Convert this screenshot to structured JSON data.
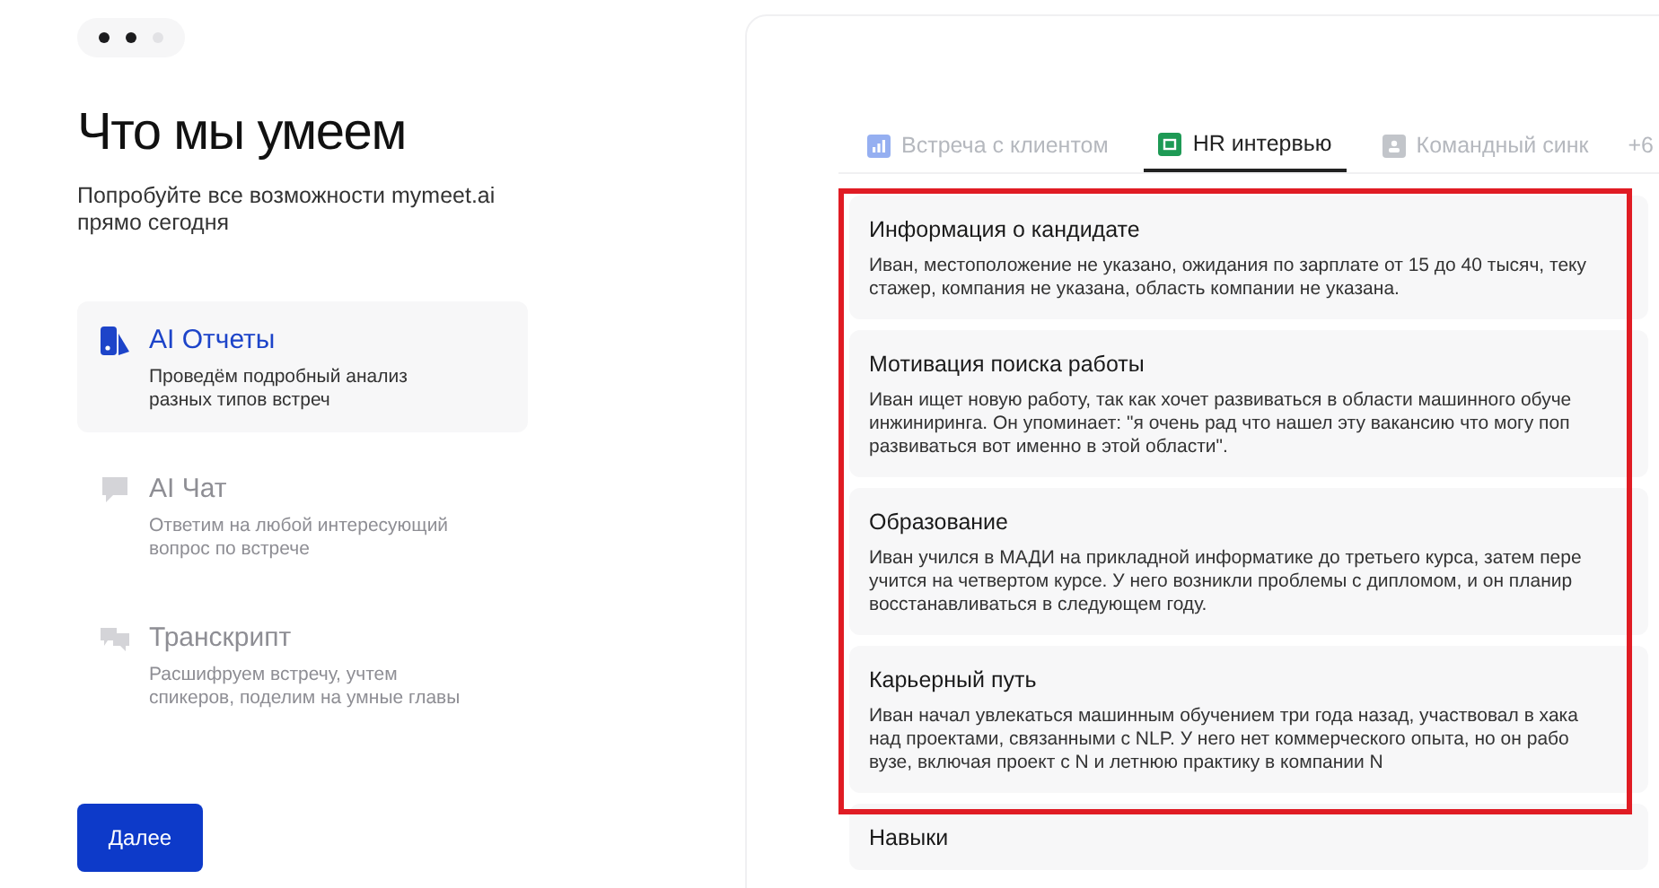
{
  "steps": [
    {
      "active": true
    },
    {
      "active": true
    },
    {
      "active": false
    }
  ],
  "title": "Что мы умеем",
  "subtitle": "Попробуйте все возможности mymeet.ai прямо сегодня",
  "features": [
    {
      "kind": "reports",
      "title": "AI Отчеты",
      "description": "Проведём подробный анализ разных типов встреч",
      "selected": true
    },
    {
      "kind": "chat",
      "title": "AI Чат",
      "description": "Ответим на любой интересующий вопрос по встрече",
      "selected": false
    },
    {
      "kind": "transcript",
      "title": "Транскрипт",
      "description": "Расшифруем встречу, учтем спикеров, поделим на умные главы",
      "selected": false
    }
  ],
  "next_button": "Далее",
  "tabs": [
    {
      "kind": "chart",
      "label": "Встреча с клиентом",
      "selected": false
    },
    {
      "kind": "sheet",
      "label": "HR интервью",
      "selected": true
    },
    {
      "kind": "team",
      "label": "Командный синк",
      "selected": false
    },
    {
      "kind": "more",
      "label": "+6",
      "selected": false
    }
  ],
  "sections": [
    {
      "title": "Информация о кандидате",
      "lines": [
        "Иван, местоположение не указано, ожидания по зарплате от 15 до 40 тысяч, теку",
        "стажер, компания не указана, область компании не указана."
      ]
    },
    {
      "title": "Мотивация поиска работы",
      "lines": [
        "Иван ищет новую работу, так как хочет развиваться в области машинного обуче",
        "инжиниринга. Он упоминает: \"я очень рад что нашел эту вакансию что могу поп",
        "развиваться вот именно в этой области\"."
      ]
    },
    {
      "title": "Образование",
      "lines": [
        "Иван учился в МАДИ на прикладной информатике до третьего курса, затем пере",
        "учится на четвертом курсе. У него возникли проблемы с дипломом, и он планир",
        "восстанавливаться в следующем году."
      ]
    },
    {
      "title": "Карьерный путь",
      "lines": [
        "Иван начал увлекаться машинным обучением три года назад, участвовал в хака",
        "над проектами, связанными с NLP. У него нет коммерческого опыта, но он рабо",
        "вузе, включая проект с N и летнюю практику в компании N"
      ]
    },
    {
      "title": "Навыки"
    }
  ]
}
